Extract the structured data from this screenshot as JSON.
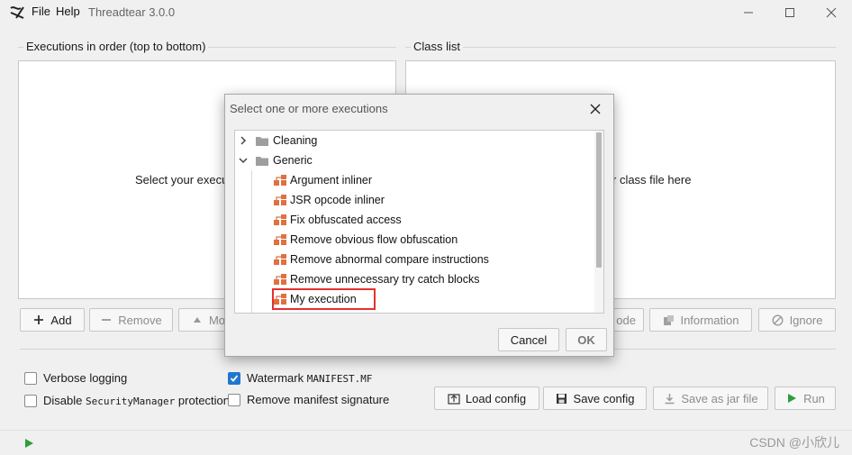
{
  "titlebar": {
    "menu": [
      "File",
      "Help"
    ],
    "app_title": "Threadtear 3.0.0"
  },
  "executions": {
    "group_title": "Executions in order (top to bottom)",
    "hint": "Select your execu",
    "buttons": {
      "add": "Add",
      "remove": "Remove",
      "move": "Mo"
    }
  },
  "class_list": {
    "group_title": "Class list",
    "hint": "r class file here",
    "buttons": {
      "decode": "ode",
      "information": "Information",
      "ignore": "Ignore"
    }
  },
  "options": {
    "verbose_logging": {
      "label": "Verbose logging",
      "checked": false
    },
    "disable_security_prefix": "Disable ",
    "disable_security_code": "SecurityManager",
    "disable_security_suffix": " protection",
    "watermark_prefix": "Watermark ",
    "watermark_code": "MANIFEST.MF",
    "watermark_checked": true,
    "remove_manifest": {
      "label": "Remove manifest signature",
      "checked": false
    }
  },
  "actions": {
    "load_config": "Load config",
    "save_config": "Save config",
    "save_jar": "Save as jar file",
    "run": "Run"
  },
  "dialog": {
    "title": "Select one or more executions",
    "tree": [
      {
        "label": "Cleaning",
        "kind": "folder",
        "expanded": false
      },
      {
        "label": "Generic",
        "kind": "folder",
        "expanded": true
      },
      {
        "label": "Argument inliner",
        "kind": "execution"
      },
      {
        "label": "JSR opcode inliner",
        "kind": "execution"
      },
      {
        "label": "Fix obfuscated access",
        "kind": "execution"
      },
      {
        "label": "Remove obvious flow obfuscation",
        "kind": "execution"
      },
      {
        "label": "Remove abnormal compare instructions",
        "kind": "execution"
      },
      {
        "label": "Remove unnecessary try catch blocks",
        "kind": "execution"
      },
      {
        "label": "My execution",
        "kind": "execution",
        "highlighted": true
      }
    ],
    "cancel": "Cancel",
    "ok": "OK"
  },
  "watermark": "CSDN @小欣儿",
  "colors": {
    "accent": "#1f77d0",
    "run_green": "#2e9e3e",
    "highlight_red": "#e53030",
    "execution_icon": "#e07040"
  }
}
